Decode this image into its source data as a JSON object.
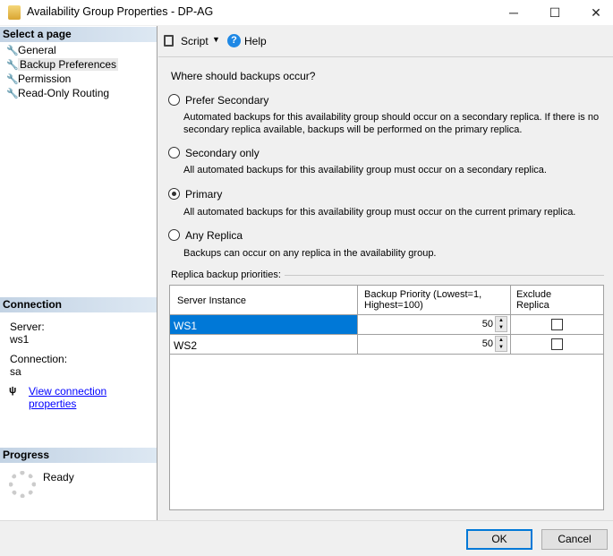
{
  "window": {
    "title": "Availability Group Properties - DP-AG",
    "minimize": "─",
    "maximize": "☐",
    "close": "✕"
  },
  "sidebar": {
    "header": "Select a page",
    "items": [
      {
        "label": "General"
      },
      {
        "label": "Backup Preferences",
        "selected": true
      },
      {
        "label": "Permission"
      },
      {
        "label": "Read-Only Routing"
      }
    ]
  },
  "connection": {
    "header": "Connection",
    "server_label": "Server:",
    "server": "ws1",
    "connection_label": "Connection:",
    "connection": "sa",
    "link": "View connection properties"
  },
  "progress": {
    "header": "Progress",
    "status": "Ready"
  },
  "toolbar": {
    "script": "Script",
    "help": "Help"
  },
  "main": {
    "question": "Where should backups occur?",
    "options": [
      {
        "label": "Prefer Secondary",
        "checked": false,
        "desc1": "Automated backups for this availability group should occur on a secondary replica. If there is no",
        "desc2": "secondary replica available, backups will be performed on the primary replica."
      },
      {
        "label": "Secondary only",
        "checked": false,
        "desc1": "All automated backups for this availability group must occur on a secondary replica."
      },
      {
        "label": "Primary",
        "checked": true,
        "desc1": "All automated backups for this availability group must occur on the current primary replica."
      },
      {
        "label": "Any Replica",
        "checked": false,
        "desc1": "Backups can occur on any replica in the availability group."
      }
    ],
    "group_label": "Replica backup priorities:",
    "table": {
      "headers": [
        "Server Instance",
        "Backup Priority (Lowest=1,",
        "Highest=100)",
        "Exclude",
        "Replica"
      ],
      "rows": [
        {
          "server": "WS1",
          "priority": "50",
          "exclude": false
        },
        {
          "server": "WS2",
          "priority": "50",
          "exclude": false
        }
      ]
    }
  },
  "footer": {
    "ok": "OK",
    "cancel": "Cancel"
  },
  "colors": {
    "selection": "#0078d7",
    "header_gradient": "#c3d3e4"
  }
}
